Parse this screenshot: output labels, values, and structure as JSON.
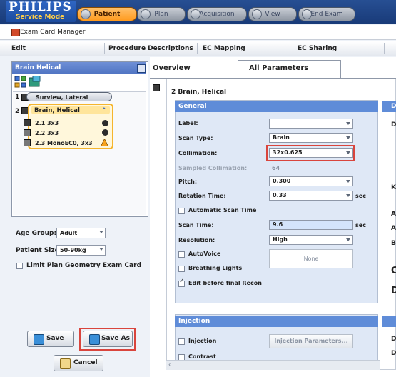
{
  "app": {
    "brand": "PHILIPS",
    "mode": "Service Mode",
    "window_title": "Exam Card Manager"
  },
  "phase_tabs": [
    {
      "label": "Patient",
      "active": true
    },
    {
      "label": "Plan",
      "active": false
    },
    {
      "label": "Acquisition",
      "active": false
    },
    {
      "label": "View",
      "active": false
    },
    {
      "label": "End Exam",
      "active": false
    }
  ],
  "menu": {
    "edit": "Edit",
    "procedure_descriptions": "Procedure Descriptions",
    "ec_mapping": "EC Mapping",
    "ec_sharing": "EC Sharing"
  },
  "exam_card": {
    "title": "Brain Helical",
    "steps": [
      {
        "num": "1",
        "label": "Survlew, Lateral"
      },
      {
        "num": "2",
        "label": "Brain, Helical",
        "children": [
          {
            "label": "2.1 3x3"
          },
          {
            "label": "2.2 3x3"
          },
          {
            "label": "2.3 MonoEC0, 3x3"
          }
        ]
      }
    ]
  },
  "left_form": {
    "age_group_label": "Age Group:",
    "age_group_value": "Adult",
    "patient_size_label": "Patient Size:",
    "patient_size_value": "50-90kg",
    "limit_plan_label": "Limit Plan Geometry Exam Card"
  },
  "buttons": {
    "save": "Save",
    "save_as": "Save As",
    "cancel": "Cancel"
  },
  "main_tabs": {
    "overview": "Overview",
    "all_parameters": "All Parameters"
  },
  "series": {
    "title": "2 Brain, Helical"
  },
  "general": {
    "header": "General",
    "label_label": "Label:",
    "label_value": "",
    "scan_type_label": "Scan Type:",
    "scan_type_value": "Brain",
    "collimation_label": "Collimation:",
    "collimation_value": "32x0.625",
    "sampled_collimation_label": "Sampled Collimation:",
    "sampled_collimation_value": "64",
    "pitch_label": "Pitch:",
    "pitch_value": "0.300",
    "rotation_time_label": "Rotation Time:",
    "rotation_time_value": "0.33",
    "rotation_time_unit": "sec",
    "automatic_scan_time_label": "Automatic Scan Time",
    "scan_time_label": "Scan Time:",
    "scan_time_value": "9.6",
    "scan_time_unit": "sec",
    "resolution_label": "Resolution:",
    "resolution_value": "High",
    "auto_voice_label": "AutoVoice",
    "auto_voice_value": "None",
    "breathing_lights_label": "Breathing Lights",
    "edit_before_final_recon_label": "Edit before final Recon",
    "edit_before_final_recon_checked": true
  },
  "injection": {
    "header": "Injection",
    "injection_label": "Injection",
    "injection_params_button": "Injection Parameters...",
    "contrast_label": "Contrast"
  },
  "right_strip": {
    "letter": "D",
    "items": [
      "D",
      "K",
      "A",
      "A",
      "B",
      "C",
      "D",
      "D",
      "D"
    ]
  },
  "colors": {
    "accent_orange": "#ff9a1e",
    "header_blue": "#5f8cd8",
    "highlight_red": "#d9453d"
  }
}
